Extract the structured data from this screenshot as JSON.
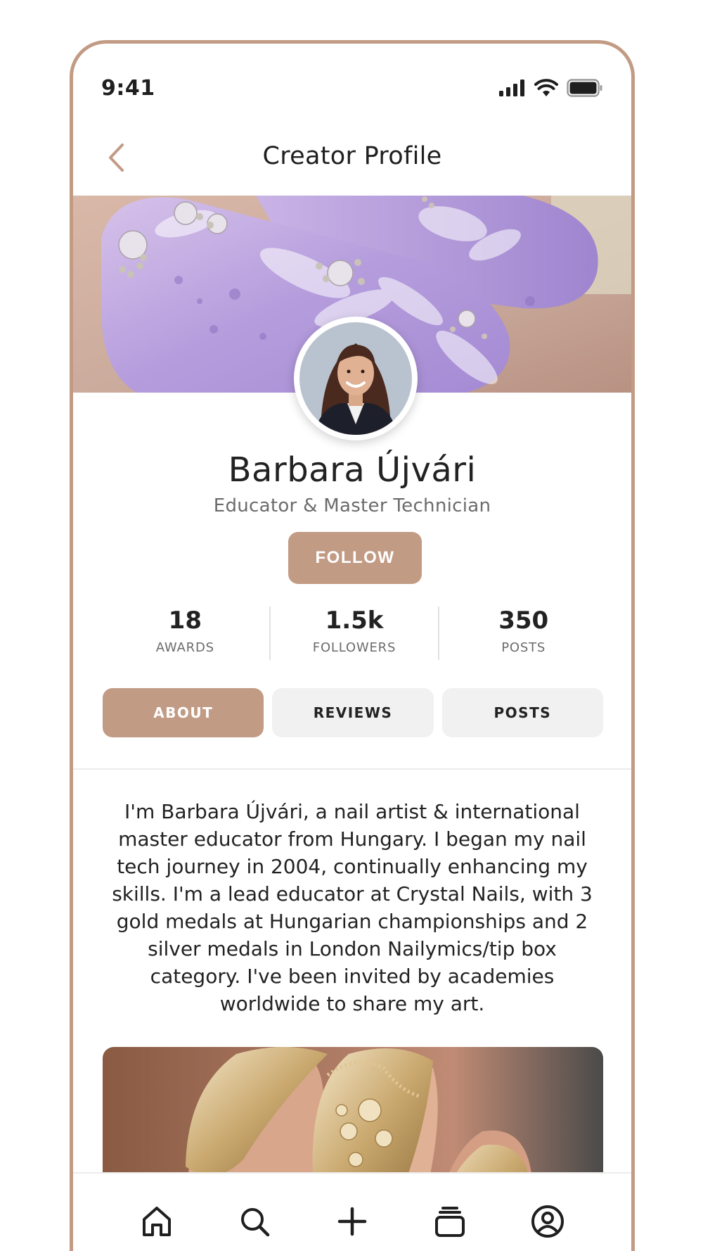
{
  "status_bar": {
    "time": "9:41"
  },
  "nav": {
    "title": "Creator Profile"
  },
  "profile": {
    "name": "Barbara Újvári",
    "role": "Educator & Master Technician",
    "follow_label": "FOLLOW"
  },
  "stats": [
    {
      "value": "18",
      "label": "AWARDS"
    },
    {
      "value": "1.5k",
      "label": "FOLLOWERS"
    },
    {
      "value": "350",
      "label": "POSTS"
    }
  ],
  "tabs": [
    {
      "label": "ABOUT",
      "active": true
    },
    {
      "label": "REVIEWS",
      "active": false
    },
    {
      "label": "POSTS",
      "active": false
    }
  ],
  "about": {
    "bio": "I'm Barbara Újvári, a nail artist & international master educator from Hungary. I began my nail tech journey in 2004, continually enhancing my skills. I'm a lead educator at Crystal Nails, with 3 gold medals at Hungarian championships and 2 silver medals in London Nailymics/tip box category. I've been invited by academies worldwide to share my art."
  },
  "bottom_nav": {
    "items": [
      {
        "icon": "home-icon"
      },
      {
        "icon": "search-icon"
      },
      {
        "icon": "plus-icon"
      },
      {
        "icon": "collections-icon"
      },
      {
        "icon": "profile-icon"
      }
    ]
  },
  "colors": {
    "accent": "#c29b85",
    "text": "#1f1f1f",
    "muted": "#6b6b6b",
    "tab_inactive_bg": "#f1f1f1"
  }
}
